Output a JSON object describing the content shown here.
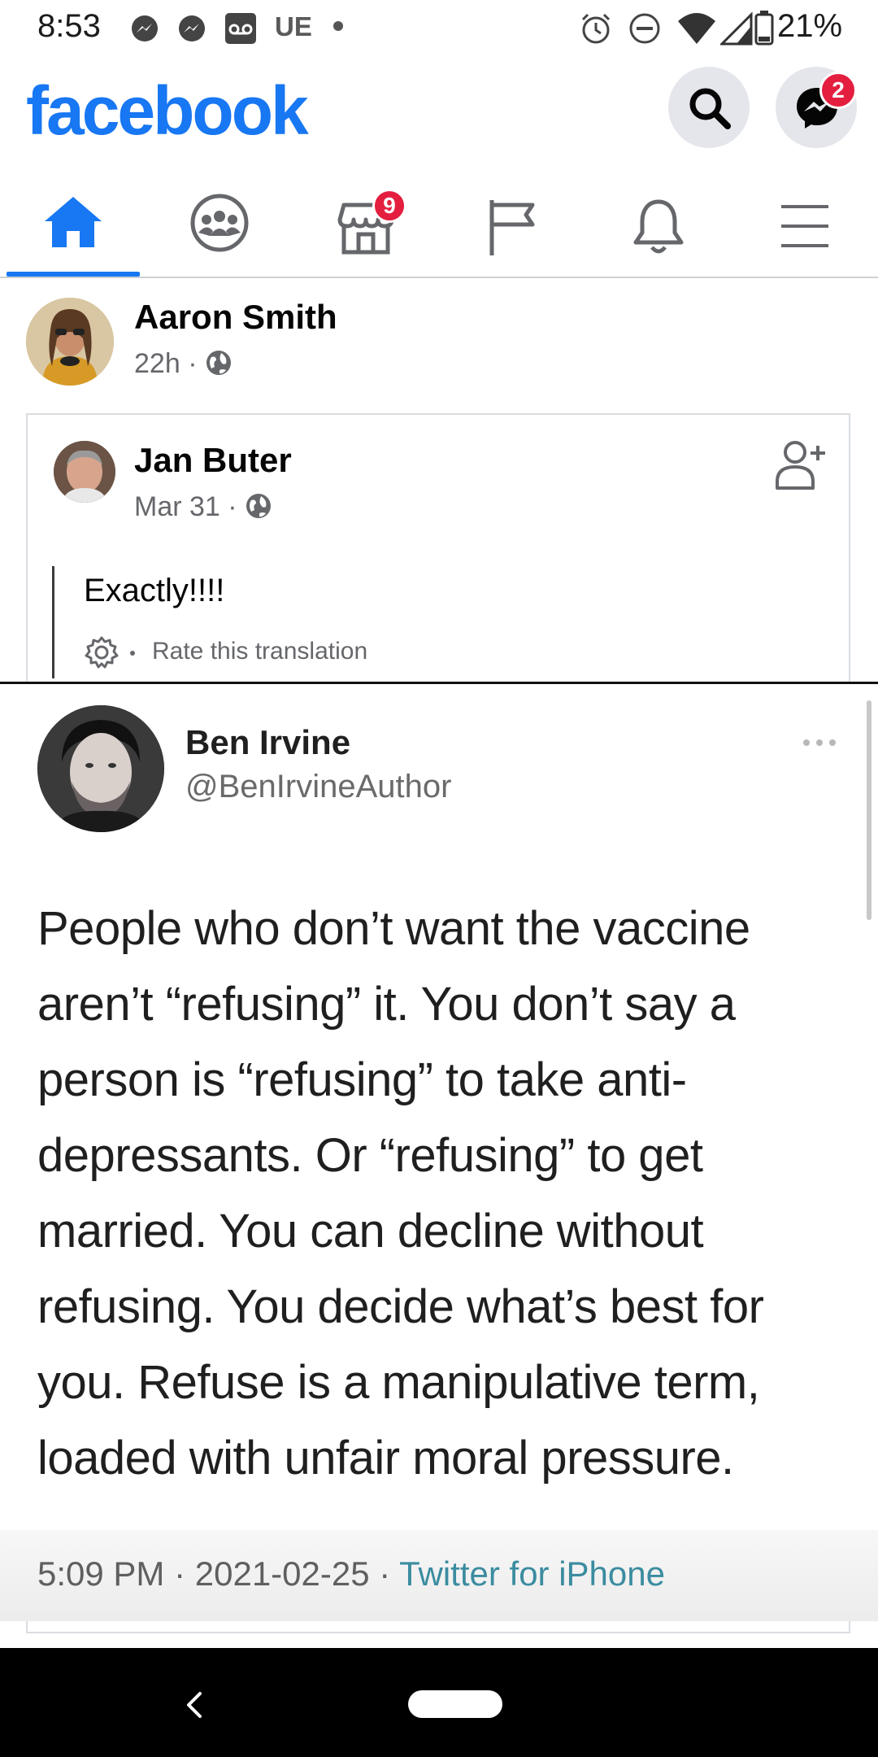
{
  "status_bar": {
    "time": "8:53",
    "carrier_tag": "UE",
    "battery": "21%"
  },
  "header": {
    "logo": "facebook",
    "messenger_badge": "2",
    "icons": [
      "search-icon",
      "messenger-icon"
    ]
  },
  "nav": {
    "tabs": [
      {
        "name": "home",
        "icon": "home-icon",
        "active": true
      },
      {
        "name": "groups",
        "icon": "groups-icon"
      },
      {
        "name": "marketplace",
        "icon": "marketplace-icon",
        "badge": "9"
      },
      {
        "name": "pages",
        "icon": "flag-icon"
      },
      {
        "name": "notifications",
        "icon": "bell-icon"
      },
      {
        "name": "menu",
        "icon": "menu-icon"
      }
    ]
  },
  "post": {
    "author": "Aaron Smith",
    "time": "22h",
    "separator": "·",
    "shared": {
      "author": "Jan Buter",
      "time": "Mar 31",
      "quote": "Exactly!!!!",
      "rate": "Rate this translation"
    }
  },
  "tweet": {
    "name": "Ben Irvine",
    "handle": "@BenIrvineAuthor",
    "body": "People who don’t want the vaccine aren’t “refusing” it. You don’t say a person is “refusing” to take anti-depressants. Or “refusing” to get married. You can decline without refusing. You decide what’s best for you. Refuse is a manipulative term, loaded with unfair moral pressure.",
    "time": "5:09 PM",
    "date": "2021-02-25",
    "source": "Twitter for iPhone"
  },
  "colors": {
    "brand": "#1877f2",
    "badge": "#e41e3f",
    "secondary_text": "#65676b"
  }
}
